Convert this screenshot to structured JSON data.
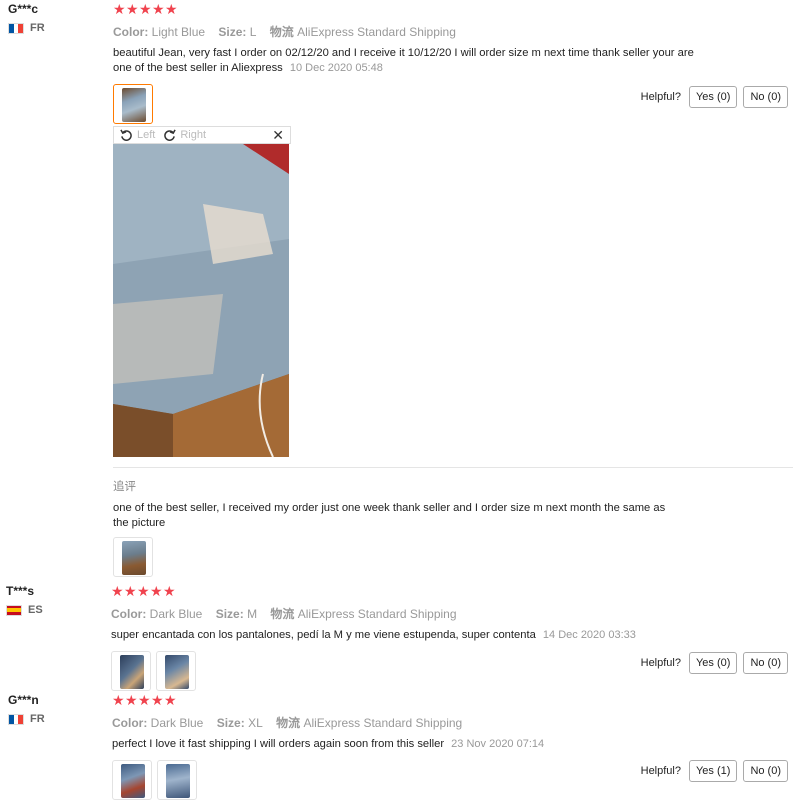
{
  "reviews": [
    {
      "user": "G***c",
      "country": "FR",
      "stars": 5,
      "color_label": "Color:",
      "color_value": "Light Blue",
      "size_label": "Size:",
      "size_value": "L",
      "shipping_label": "物流",
      "shipping_value": "AliExpress Standard Shipping",
      "text": "beautiful Jean, very fast I order on 02/12/20 and I receive it 10/12/20 I will order size m next time thank seller your are one of the best seller in Aliexpress",
      "date": "10 Dec 2020 05:48",
      "helpful_label": "Helpful?",
      "yes_label": "Yes (0)",
      "no_label": "No (0)",
      "viewer": {
        "left_label": "Left",
        "right_label": "Right",
        "close": "✕"
      },
      "followup_label": "追评",
      "followup_text": "one of the best seller, I received my order just one week thank seller and I order size m next month the same as the picture"
    },
    {
      "user": "T***s",
      "country": "ES",
      "stars": 5,
      "color_label": "Color:",
      "color_value": "Dark Blue",
      "size_label": "Size:",
      "size_value": "M",
      "shipping_label": "物流",
      "shipping_value": "AliExpress Standard Shipping",
      "text": "super encantada con los pantalones, pedí la M y me viene estupenda, super contenta",
      "date": "14 Dec 2020 03:33",
      "helpful_label": "Helpful?",
      "yes_label": "Yes (0)",
      "no_label": "No (0)"
    },
    {
      "user": "G***n",
      "country": "FR",
      "stars": 5,
      "color_label": "Color:",
      "color_value": "Dark Blue",
      "size_label": "Size:",
      "size_value": "XL",
      "shipping_label": "物流",
      "shipping_value": "AliExpress Standard Shipping",
      "text": "perfect I love it fast shipping I will orders again soon from this seller",
      "date": "23 Nov 2020 07:14",
      "helpful_label": "Helpful?",
      "yes_label": "Yes (1)",
      "no_label": "No (0)"
    }
  ],
  "colors": {
    "star": "#f0434e",
    "active_thumb": "#ff7a00",
    "muted": "#999999"
  }
}
